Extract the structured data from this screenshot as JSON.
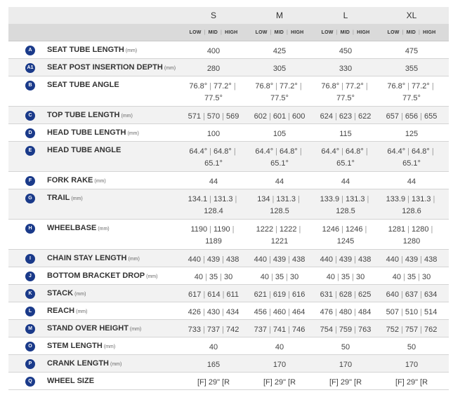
{
  "sizes": [
    "S",
    "M",
    "L",
    "XL"
  ],
  "sub_headers": [
    "LOW",
    "MID",
    "HIGH"
  ],
  "rows": [
    {
      "letter": "A",
      "label": "SEAT TUBE LENGTH",
      "unit": "(mm)",
      "values": [
        "400",
        "425",
        "450",
        "475"
      ]
    },
    {
      "letter": "A1",
      "label": "SEAT POST INSERTION DEPTH",
      "unit": "(mm)",
      "values": [
        "280",
        "305",
        "330",
        "355"
      ]
    },
    {
      "letter": "B",
      "label": "SEAT TUBE ANGLE",
      "unit": "",
      "values": [
        [
          "76.8°",
          "77.2°",
          "77.5°"
        ],
        [
          "76.8°",
          "77.2°",
          "77.5°"
        ],
        [
          "76.8°",
          "77.2°",
          "77.5°"
        ],
        [
          "76.8°",
          "77.2°",
          "77.5°"
        ]
      ]
    },
    {
      "letter": "C",
      "label": "TOP TUBE LENGTH",
      "unit": "(mm)",
      "values": [
        [
          "571",
          "570",
          "569"
        ],
        [
          "602",
          "601",
          "600"
        ],
        [
          "624",
          "623",
          "622"
        ],
        [
          "657",
          "656",
          "655"
        ]
      ]
    },
    {
      "letter": "D",
      "label": "HEAD TUBE LENGTH",
      "unit": "(mm)",
      "values": [
        "100",
        "105",
        "115",
        "125"
      ]
    },
    {
      "letter": "E",
      "label": "HEAD TUBE ANGLE",
      "unit": "",
      "values": [
        [
          "64.4°",
          "64.8°",
          "65.1°"
        ],
        [
          "64.4°",
          "64.8°",
          "65.1°"
        ],
        [
          "64.4°",
          "64.8°",
          "65.1°"
        ],
        [
          "64.4°",
          "64.8°",
          "65.1°"
        ]
      ]
    },
    {
      "letter": "F",
      "label": "FORK RAKE",
      "unit": "(mm)",
      "values": [
        "44",
        "44",
        "44",
        "44"
      ]
    },
    {
      "letter": "G",
      "label": "TRAIL",
      "unit": "(mm)",
      "values": [
        [
          "134.1",
          "131.3",
          "128.4"
        ],
        [
          "134",
          "131.3",
          "128.5"
        ],
        [
          "133.9",
          "131.3",
          "128.5"
        ],
        [
          "133.9",
          "131.3",
          "128.6"
        ]
      ]
    },
    {
      "letter": "H",
      "label": "WHEELBASE",
      "unit": "(mm)",
      "values": [
        [
          "1190",
          "1190",
          "1189"
        ],
        [
          "1222",
          "1222",
          "1221"
        ],
        [
          "1246",
          "1246",
          "1245"
        ],
        [
          "1281",
          "1280",
          "1280"
        ]
      ]
    },
    {
      "letter": "I",
      "label": "CHAIN STAY LENGTH",
      "unit": "(mm)",
      "values": [
        [
          "440",
          "439",
          "438"
        ],
        [
          "440",
          "439",
          "438"
        ],
        [
          "440",
          "439",
          "438"
        ],
        [
          "440",
          "439",
          "438"
        ]
      ]
    },
    {
      "letter": "J",
      "label": "BOTTOM BRACKET DROP",
      "unit": "(mm)",
      "values": [
        [
          "40",
          "35",
          "30"
        ],
        [
          "40",
          "35",
          "30"
        ],
        [
          "40",
          "35",
          "30"
        ],
        [
          "40",
          "35",
          "30"
        ]
      ]
    },
    {
      "letter": "K",
      "label": "STACK",
      "unit": "(mm)",
      "values": [
        [
          "617",
          "614",
          "611"
        ],
        [
          "621",
          "619",
          "616"
        ],
        [
          "631",
          "628",
          "625"
        ],
        [
          "640",
          "637",
          "634"
        ]
      ]
    },
    {
      "letter": "L",
      "label": "REACH",
      "unit": "(mm)",
      "values": [
        [
          "426",
          "430",
          "434"
        ],
        [
          "456",
          "460",
          "464"
        ],
        [
          "476",
          "480",
          "484"
        ],
        [
          "507",
          "510",
          "514"
        ]
      ]
    },
    {
      "letter": "M",
      "label": "STAND OVER HEIGHT",
      "unit": "(mm)",
      "values": [
        [
          "733",
          "737",
          "742"
        ],
        [
          "737",
          "741",
          "746"
        ],
        [
          "754",
          "759",
          "763"
        ],
        [
          "752",
          "757",
          "762"
        ]
      ]
    },
    {
      "letter": "O",
      "label": "STEM LENGTH",
      "unit": "(mm)",
      "values": [
        "40",
        "40",
        "50",
        "50"
      ]
    },
    {
      "letter": "P",
      "label": "CRANK LENGTH",
      "unit": "(mm)",
      "values": [
        "165",
        "170",
        "170",
        "170"
      ]
    },
    {
      "letter": "Q",
      "label": "WHEEL SIZE",
      "unit": "",
      "values": [
        "[F] 29\" [R",
        "[F] 29\" [R",
        "[F] 29\" [R",
        "[F] 29\" [R"
      ]
    }
  ],
  "colors": {
    "badge": "#1a3a8a",
    "header_bg": "#ececec",
    "subheader_bg": "#dadada",
    "alt_row": "#f2f2f2"
  }
}
